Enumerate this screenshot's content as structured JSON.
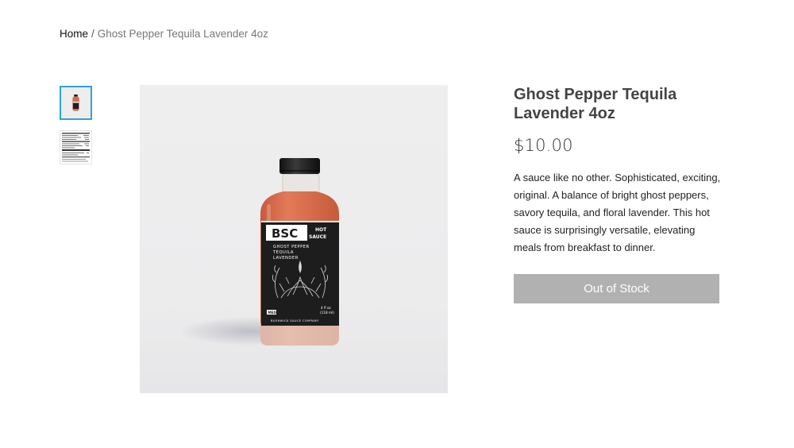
{
  "breadcrumb": {
    "home": "Home",
    "separator": "/",
    "current": "Ghost Pepper Tequila Lavender 4oz"
  },
  "gallery": {
    "thumbnails": [
      {
        "icon": "bottle-thumbnail-icon",
        "selected": true
      },
      {
        "icon": "nutrition-label-thumbnail-icon",
        "selected": false
      }
    ]
  },
  "product": {
    "title": "Ghost Pepper Tequila Lavender 4oz",
    "price": "$10.00",
    "description": "A sauce like no other. Sophisticated, exciting, original. A balance of bright ghost peppers, savory tequila, and floral lavender. This hot sauce is surprisingly versatile, elevating meals from breakfast to dinner.",
    "stock_button": "Out of Stock"
  },
  "bottle_label": {
    "brand": "BSC",
    "type_line1": "HOT",
    "type_line2": "SAUCE",
    "flavor_line1": "GHOST PEPPER",
    "flavor_line2": "TEQUILA",
    "flavor_line3": "LAVENDER",
    "heat": "MED",
    "volume_line1": "4 fl oz",
    "volume_line2": "(118 ml)",
    "company": "BUSHWICK SAUCE COMPANY"
  },
  "colors": {
    "accent": "#2ea3dd",
    "button_disabled": "#b1b1b1",
    "sauce": "#d9694a"
  }
}
